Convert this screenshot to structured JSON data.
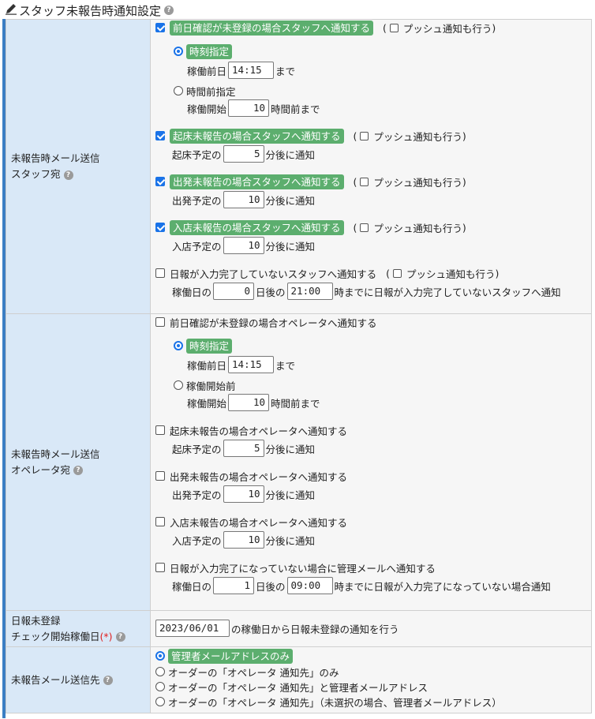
{
  "title": "スタッフ未報告時通知設定",
  "push": "プッシュ通知も行う",
  "staff": {
    "label1": "未報告時メール送信",
    "label2": "スタッフ宛",
    "prev": {
      "label": "前日確認が未登録の場合スタッフへ通知する",
      "r1": "時刻指定",
      "r1_pre": "稼働前日",
      "r1_val": "14:15",
      "r1_suf": "まで",
      "r2": "時間前指定",
      "r2_pre": "稼働開始",
      "r2_val": "10",
      "r2_suf": "時間前まで"
    },
    "wake": {
      "label": "起床未報告の場合スタッフへ通知する",
      "pre": "起床予定の",
      "val": "5",
      "suf": "分後に通知"
    },
    "depart": {
      "label": "出発未報告の場合スタッフへ通知する",
      "pre": "出発予定の",
      "val": "10",
      "suf": "分後に通知"
    },
    "enter": {
      "label": "入店未報告の場合スタッフへ通知する",
      "pre": "入店予定の",
      "val": "10",
      "suf": "分後に通知"
    },
    "daily": {
      "label": "日報が入力完了していないスタッフへ通知する",
      "pre": "稼働日の",
      "val": "0",
      "mid": "日後の",
      "time": "21:00",
      "suf": "時までに日報が入力完了していないスタッフへ通知"
    }
  },
  "op": {
    "label1": "未報告時メール送信",
    "label2": "オペレータ宛",
    "prev": {
      "label": "前日確認が未登録の場合オペレータへ通知する",
      "r1": "時刻指定",
      "r1_pre": "稼働前日",
      "r1_val": "14:15",
      "r1_suf": "まで",
      "r2": "稼働開始前",
      "r2_pre": "稼働開始",
      "r2_val": "10",
      "r2_suf": "時間前まで"
    },
    "wake": {
      "label": "起床未報告の場合オペレータへ通知する",
      "pre": "起床予定の",
      "val": "5",
      "suf": "分後に通知"
    },
    "depart": {
      "label": "出発未報告の場合オペレータへ通知する",
      "pre": "出発予定の",
      "val": "10",
      "suf": "分後に通知"
    },
    "enter": {
      "label": "入店未報告の場合オペレータへ通知する",
      "pre": "入店予定の",
      "val": "10",
      "suf": "分後に通知"
    },
    "daily": {
      "label": "日報が入力完了になっていない場合に管理メールへ通知する",
      "pre": "稼働日の",
      "val": "1",
      "mid": "日後の",
      "time": "09:00",
      "suf": "時までに日報が入力完了になっていない場合通知"
    }
  },
  "start": {
    "label1": "日報未登録",
    "label2": "チェック開始稼働日",
    "req": "(*)",
    "val": "2023/06/01",
    "suf": "の稼働日から日報未登録の通知を行う"
  },
  "dest": {
    "label": "未報告メール送信先",
    "o1": "管理者メールアドレスのみ",
    "o2": "オーダーの「オペレータ 通知先」のみ",
    "o3": "オーダーの「オペレータ 通知先」と管理者メールアドレス",
    "o4": "オーダーの「オペレータ 通知先」（未選択の場合、管理者メールアドレス）"
  },
  "colors": {
    "accent": "#1a73e8",
    "highlight": "#5cae6e",
    "label_bg": "#d9e8f7",
    "frame": "#3b7ec4"
  }
}
